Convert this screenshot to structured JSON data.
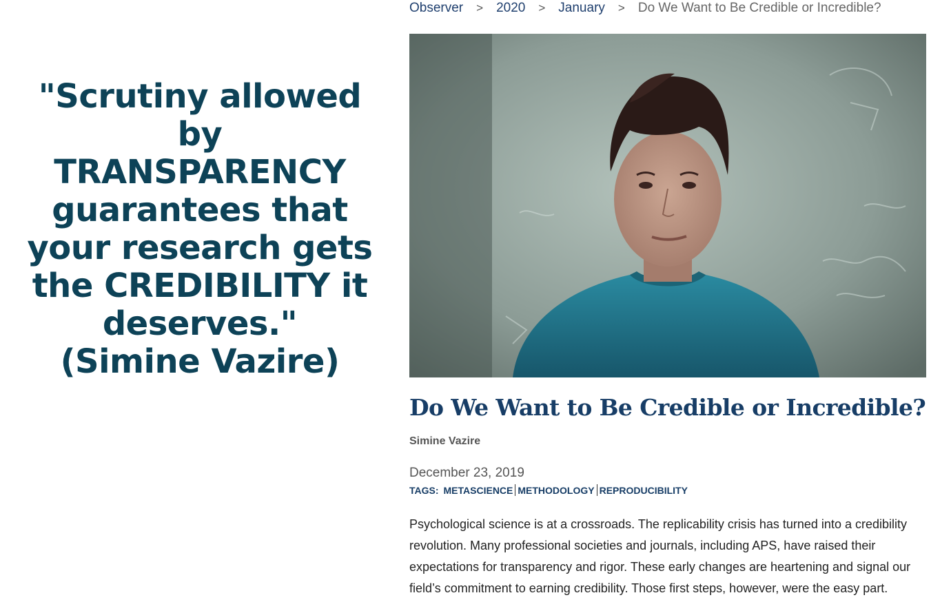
{
  "quote": {
    "lines": [
      "\"Scrutiny allowed by",
      "TRANSPARENCY",
      "guarantees that",
      "your research gets",
      "the CREDIBILITY it",
      "deserves.\"",
      "(Simine Vazire)"
    ]
  },
  "breadcrumb": {
    "items": [
      "Observer",
      "2020",
      "January"
    ],
    "separator": ">",
    "current": "Do We Want to Be Credible or Incredible?"
  },
  "article": {
    "hero_image": "portrait photo of a woman with short dark hair in a teal sweater in front of a chalkboard",
    "title": "Do We Want to Be Credible or Incredible?",
    "author": "Simine Vazire",
    "date": "December 23, 2019",
    "tags_label": "TAGS:",
    "tags": [
      "METASCIENCE",
      "METHODOLOGY",
      "REPRODUCIBILITY"
    ],
    "body": "Psychological science is at a crossroads. The replicability crisis has turned into a credibility revolution. Many professional societies and journals, including APS, have raised their expectations for transparency and rigor. These early changes are heartening and signal our field’s commitment to earning credibility. Those first steps, however, were the easy part."
  },
  "colors": {
    "quote": "#0d4257",
    "link": "#1f3f6e",
    "title": "#173d66",
    "meta": "#555555"
  }
}
